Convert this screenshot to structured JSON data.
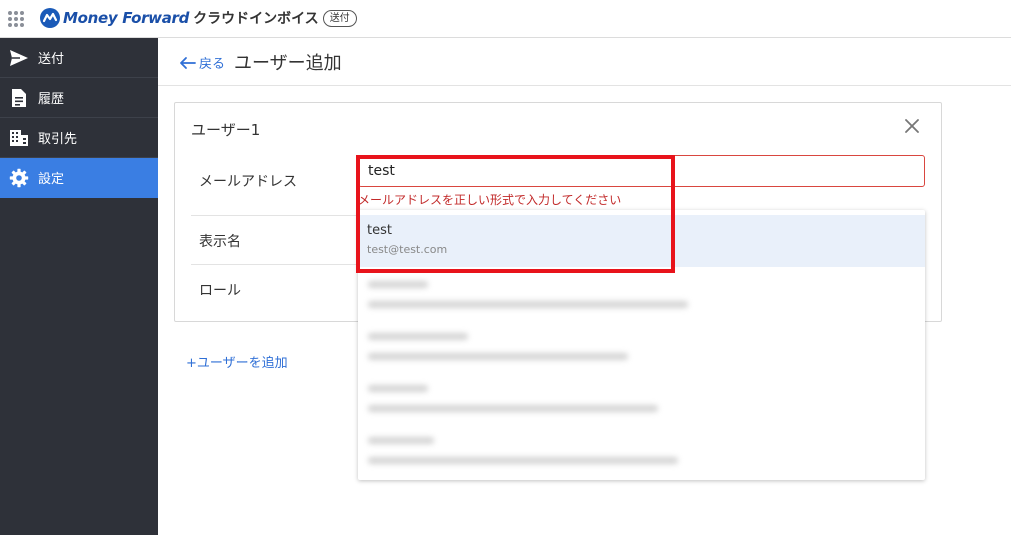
{
  "header": {
    "brand_name": "Money Forward",
    "product_name": "クラウドインボイス",
    "badge": "送付",
    "apps_icon": "grid-dots-icon",
    "brand_color": "#1a5ab8"
  },
  "sidebar": {
    "items": [
      {
        "label": "送付",
        "icon": "send-icon",
        "active": false
      },
      {
        "label": "履歴",
        "icon": "document-icon",
        "active": false
      },
      {
        "label": "取引先",
        "icon": "building-icon",
        "active": false
      },
      {
        "label": "設定",
        "icon": "gear-icon",
        "active": true
      }
    ],
    "active_color": "#3a7ee3"
  },
  "page": {
    "back_label": "戻る",
    "title": "ユーザー追加"
  },
  "user_card": {
    "title": "ユーザー1",
    "email_label": "メールアドレス",
    "email_value": "test",
    "email_error": "メールアドレスを正しい形式で入力してください",
    "display_name_label": "表示名",
    "role_label": "ロール"
  },
  "suggestions": {
    "highlighted": {
      "name": "test",
      "email": "test@test.com"
    }
  },
  "add_user_label": "ユーザーを追加",
  "colors": {
    "error": "#c22a2a",
    "link": "#2f6fd6",
    "annotation_box": "#e8131b"
  }
}
